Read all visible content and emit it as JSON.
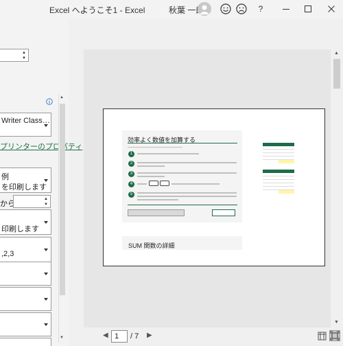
{
  "titlebar": {
    "title": "Excel へようこそ1 - Excel",
    "user": "秋葉 一郎"
  },
  "left": {
    "printer_name": "Writer Class…",
    "printer_props_link": "プリンターのプロパティ",
    "print_what_line1": "例",
    "print_what_line2": "を印刷します",
    "pages_from_label": "から",
    "pages_from_value": "",
    "collate_line": "印刷します",
    "collate_value": ",2,3"
  },
  "preview": {
    "slide_title": "効率よく数値を加算する",
    "steps": [
      "1",
      "2",
      "3",
      "4",
      "5"
    ],
    "section2_title": "SUM 関数の詳細"
  },
  "pager": {
    "current_page": "1",
    "total_pages": "/ 7"
  },
  "colors": {
    "accent_green": "#1e6b4a",
    "link_green": "#1e7145"
  }
}
